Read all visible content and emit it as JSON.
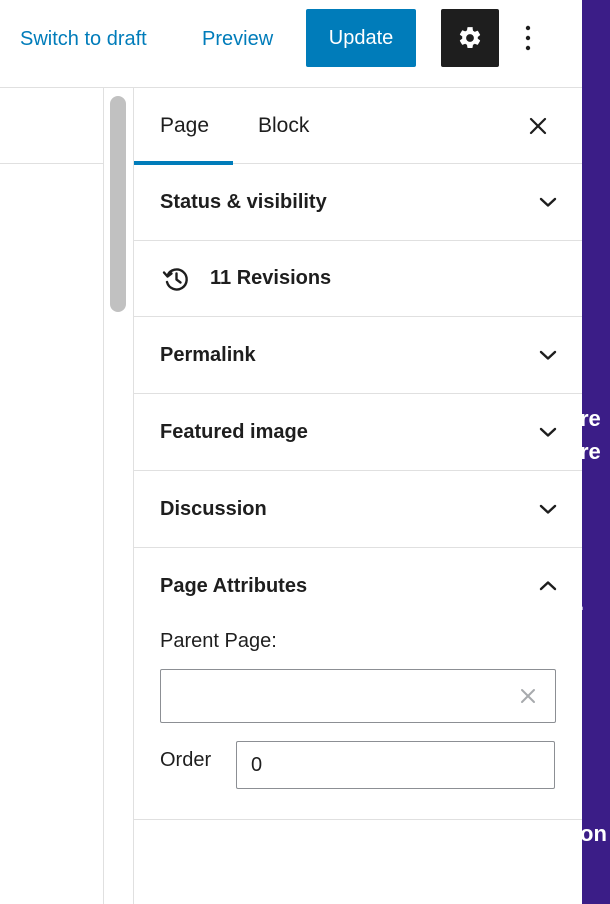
{
  "toolbar": {
    "switch_to_draft": "Switch to draft",
    "preview": "Preview",
    "update": "Update",
    "settings_icon": "gear-icon",
    "more_icon": "vertical-ellipsis-icon"
  },
  "sidebar": {
    "tabs": [
      {
        "label": "Page",
        "active": true
      },
      {
        "label": "Block",
        "active": false
      }
    ],
    "close_icon": "close-icon",
    "panels": {
      "status_visibility": "Status & visibility",
      "revisions": "11 Revisions",
      "permalink": "Permalink",
      "featured_image": "Featured image",
      "discussion": "Discussion",
      "page_attributes": "Page Attributes"
    },
    "page_attributes": {
      "parent_label": "Parent Page:",
      "parent_value": "",
      "order_label": "Order",
      "order_value": "0"
    }
  },
  "preview_strip": {
    "fragment_1": "re",
    "fragment_2": "re",
    "fragment_3": ".",
    "fragment_4": "on"
  },
  "colors": {
    "accent": "#007cba",
    "dark": "#1e1e1e",
    "preview_bg": "#3b1d87"
  }
}
